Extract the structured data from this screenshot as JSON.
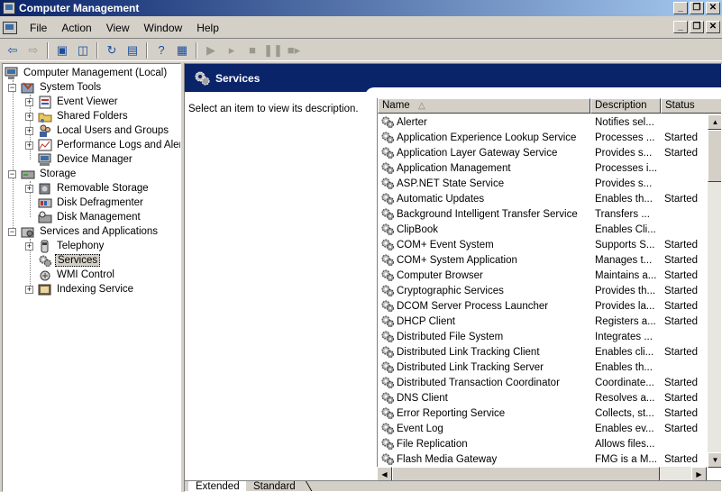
{
  "window": {
    "title": "Computer Management"
  },
  "menu": {
    "items": [
      "File",
      "Action",
      "View",
      "Window",
      "Help"
    ]
  },
  "tree": {
    "root": "Computer Management (Local)",
    "system_tools": "System Tools",
    "event_viewer": "Event Viewer",
    "shared_folders": "Shared Folders",
    "local_users": "Local Users and Groups",
    "perf_logs": "Performance Logs and Alerts",
    "device_manager": "Device Manager",
    "storage": "Storage",
    "removable_storage": "Removable Storage",
    "disk_defrag": "Disk Defragmenter",
    "disk_mgmt": "Disk Management",
    "services_apps": "Services and Applications",
    "telephony": "Telephony",
    "services": "Services",
    "wmi": "WMI Control",
    "indexing": "Indexing Service"
  },
  "pane": {
    "title": "Services",
    "description_hint": "Select an item to view its description."
  },
  "list": {
    "columns": {
      "name": "Name",
      "description": "Description",
      "status": "Status"
    },
    "rows": [
      {
        "name": "Alerter",
        "description": "Notifies sel...",
        "status": ""
      },
      {
        "name": "Application Experience Lookup Service",
        "description": "Processes ...",
        "status": "Started"
      },
      {
        "name": "Application Layer Gateway Service",
        "description": "Provides s...",
        "status": "Started"
      },
      {
        "name": "Application Management",
        "description": "Processes i...",
        "status": ""
      },
      {
        "name": "ASP.NET State Service",
        "description": "Provides s...",
        "status": ""
      },
      {
        "name": "Automatic Updates",
        "description": "Enables th...",
        "status": "Started"
      },
      {
        "name": "Background Intelligent Transfer Service",
        "description": "Transfers ...",
        "status": ""
      },
      {
        "name": "ClipBook",
        "description": "Enables Cli...",
        "status": ""
      },
      {
        "name": "COM+ Event System",
        "description": "Supports S...",
        "status": "Started"
      },
      {
        "name": "COM+ System Application",
        "description": "Manages t...",
        "status": "Started"
      },
      {
        "name": "Computer Browser",
        "description": "Maintains a...",
        "status": "Started"
      },
      {
        "name": "Cryptographic Services",
        "description": "Provides th...",
        "status": "Started"
      },
      {
        "name": "DCOM Server Process Launcher",
        "description": "Provides la...",
        "status": "Started"
      },
      {
        "name": "DHCP Client",
        "description": "Registers a...",
        "status": "Started"
      },
      {
        "name": "Distributed File System",
        "description": "Integrates ...",
        "status": ""
      },
      {
        "name": "Distributed Link Tracking Client",
        "description": "Enables cli...",
        "status": "Started"
      },
      {
        "name": "Distributed Link Tracking Server",
        "description": "Enables th...",
        "status": ""
      },
      {
        "name": "Distributed Transaction Coordinator",
        "description": "Coordinate...",
        "status": "Started"
      },
      {
        "name": "DNS Client",
        "description": "Resolves a...",
        "status": "Started"
      },
      {
        "name": "Error Reporting Service",
        "description": "Collects, st...",
        "status": "Started"
      },
      {
        "name": "Event Log",
        "description": "Enables ev...",
        "status": "Started"
      },
      {
        "name": "File Replication",
        "description": "Allows files...",
        "status": ""
      },
      {
        "name": "Flash Media Gateway",
        "description": "FMG is a M...",
        "status": "Started"
      }
    ]
  },
  "tabs": [
    "Extended",
    "Standard"
  ]
}
